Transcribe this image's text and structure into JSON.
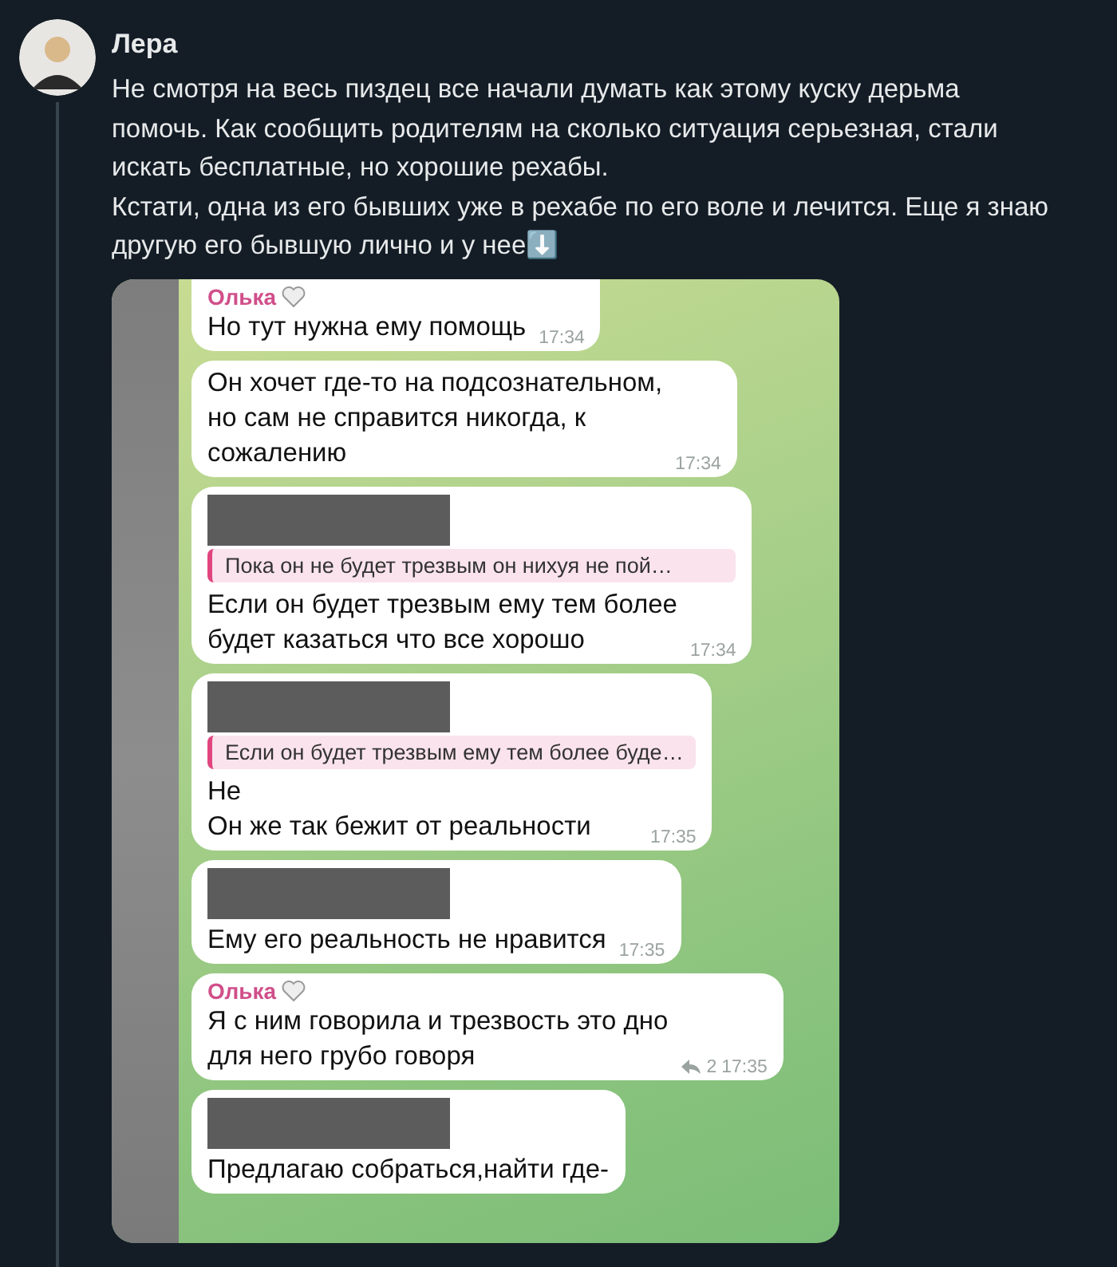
{
  "post": {
    "author": "Лера",
    "paragraphs": [
      "Не смотря на весь пиздец все начали думать как этому куску дерьма помочь. Как сообщить родителям на сколько ситуация серьезная, стали искать бесплатные, но хорошие рехабы.",
      "Кстати, одна из его бывших уже в рехабе по его воле и лечится. Еще я знаю другую его бывшую лично и у нее⬇️"
    ]
  },
  "chat": {
    "messages": [
      {
        "sender": "Олька",
        "sender_redacted": false,
        "lines": [
          "Но тут нужна ему помощь"
        ],
        "time": "17:34"
      },
      {
        "sender_redacted": false,
        "lines": [
          "Он хочет где-то на подсознательном,",
          "но сам не справится никогда, к",
          "сожалению"
        ],
        "time": "17:34"
      },
      {
        "sender_redacted": true,
        "quote": "Пока он не будет трезвым он нихуя не пой…",
        "lines": [
          "Если он будет трезвым ему тем более",
          "будет казаться что все хорошо"
        ],
        "time": "17:34"
      },
      {
        "sender_redacted": true,
        "quote": "Если он будет трезвым ему тем более буде…",
        "lines": [
          "Не",
          "Он же так бежит от реальности"
        ],
        "time": "17:35"
      },
      {
        "sender_redacted": true,
        "lines": [
          "Ему его реальность не нравится"
        ],
        "time": "17:35"
      },
      {
        "sender": "Олька",
        "sender_redacted": false,
        "lines": [
          "Я с ним говорила и трезвость это дно",
          "для него грубо говоря"
        ],
        "replies": "2",
        "time": "17:35"
      },
      {
        "sender_redacted": true,
        "lines": [
          "Предлагаю собраться,найти где-"
        ]
      }
    ]
  }
}
